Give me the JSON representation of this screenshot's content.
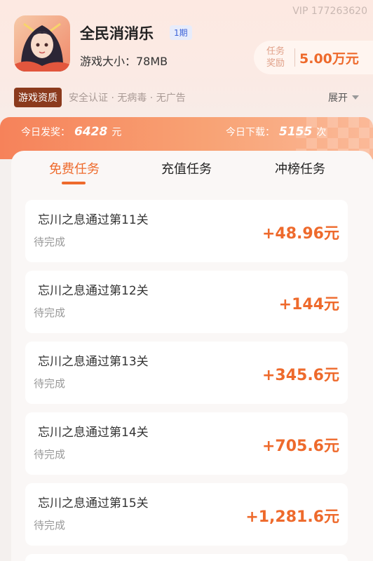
{
  "header": {
    "vip_id": "VIP 177263620",
    "app_name": "全民消消乐",
    "period": "1期",
    "size_label": "游戏大小：78MB",
    "reward_label_line1": "任务",
    "reward_label_line2": "奖励",
    "reward_value": "5.00万元",
    "qual_badge": "游戏资质",
    "qual_text": "安全认证 · 无病毒 · 无广告",
    "expand_label": "展开",
    "icon": "game-avatar-icon"
  },
  "stats": {
    "today_award_label": "今日发奖：",
    "today_award_value": "6428",
    "today_award_unit": "元",
    "today_download_label": "今日下载：",
    "today_download_value": "5155",
    "today_download_unit": "次"
  },
  "tabs": [
    {
      "label": "免费任务",
      "active": true
    },
    {
      "label": "充值任务",
      "active": false
    },
    {
      "label": "冲榜任务",
      "active": false
    }
  ],
  "tasks": [
    {
      "title": "忘川之息通过第11关",
      "status": "待完成",
      "reward": "+48.96元"
    },
    {
      "title": "忘川之息通过第12关",
      "status": "待完成",
      "reward": "+144元"
    },
    {
      "title": "忘川之息通过第13关",
      "status": "待完成",
      "reward": "+345.6元"
    },
    {
      "title": "忘川之息通过第14关",
      "status": "待完成",
      "reward": "+705.6元"
    },
    {
      "title": "忘川之息通过第15关",
      "status": "待完成",
      "reward": "+1,281.6元"
    }
  ],
  "colors": {
    "accent": "#ee6a2c",
    "badge_brown": "#8b3a1d",
    "period_blue": "#3d63d8"
  }
}
